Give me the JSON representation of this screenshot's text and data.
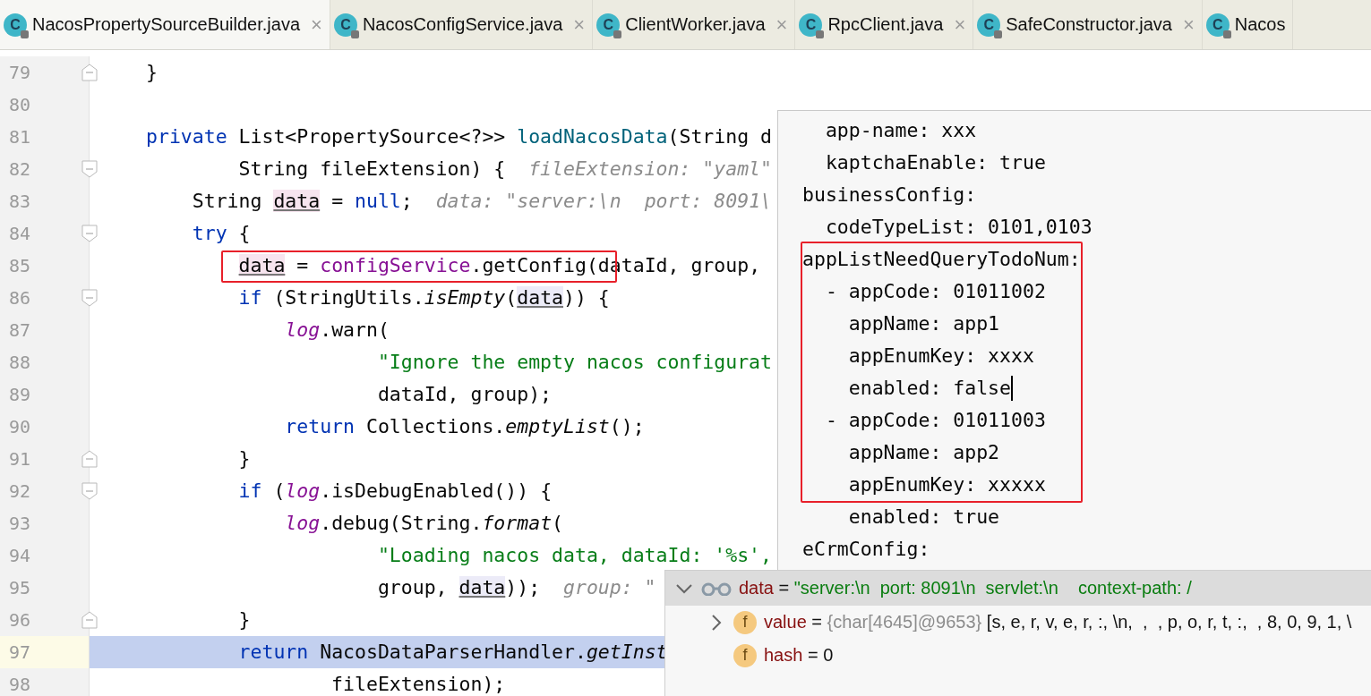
{
  "tabs": [
    {
      "icon": "C",
      "label": "NacosPropertySourceBuilder.java",
      "close": "×",
      "selected": true
    },
    {
      "icon": "C",
      "label": "NacosConfigService.java",
      "close": "×",
      "selected": false
    },
    {
      "icon": "C",
      "label": "ClientWorker.java",
      "close": "×",
      "selected": false
    },
    {
      "icon": "C",
      "label": "RpcClient.java",
      "close": "×",
      "selected": false
    },
    {
      "icon": "C",
      "label": "SafeConstructor.java",
      "close": "×",
      "selected": false
    },
    {
      "icon": "C",
      "label": "Nacos",
      "selected": false
    }
  ],
  "code_lines": [
    {
      "number": "79",
      "fold_end": true,
      "current": false,
      "tokens": [
        {
          "kind": "plain",
          "text": "}"
        }
      ]
    },
    {
      "number": "80",
      "current": false
    },
    {
      "number": "81",
      "current": false,
      "tokens": [
        {
          "kind": "keyword",
          "text": "private"
        },
        {
          "kind": "plain",
          "text": " List<PropertySource<?>> "
        },
        {
          "kind": "method",
          "text": "loadNacosData"
        },
        {
          "kind": "plain",
          "text": "(String d"
        }
      ]
    },
    {
      "number": "82",
      "fold_start": true,
      "current": false,
      "tokens": [
        {
          "kind": "plain",
          "text": "        String fileExtension) {"
        },
        {
          "kind": "hint",
          "text": "  fileExtension: \"yaml\""
        }
      ]
    },
    {
      "number": "83",
      "current": false,
      "tokens": [
        {
          "kind": "plain",
          "text": "    String "
        },
        {
          "kind": "var-write",
          "text": "data"
        },
        {
          "kind": "plain",
          "text": " = "
        },
        {
          "kind": "keyword",
          "text": "null"
        },
        {
          "kind": "plain",
          "text": ";"
        },
        {
          "kind": "hint",
          "text": "  data: \"server:\\n  port: 8091\\"
        }
      ]
    },
    {
      "number": "84",
      "fold_start": true,
      "current": false,
      "tokens": [
        {
          "kind": "keyword",
          "text": "    try"
        },
        {
          "kind": "plain",
          "text": " {"
        }
      ]
    },
    {
      "number": "85",
      "current": false,
      "boxed": true,
      "tokens": [
        {
          "kind": "var-write",
          "text": "        data"
        },
        {
          "kind": "plain",
          "text": " = "
        },
        {
          "kind": "field",
          "text": "configService"
        },
        {
          "kind": "plain",
          "text": ".getConfig(dataId, group,"
        }
      ]
    },
    {
      "number": "86",
      "fold_start": true,
      "current": false,
      "tokens": [
        {
          "kind": "keyword",
          "text": "        if"
        },
        {
          "kind": "plain",
          "text": " (StringUtils."
        },
        {
          "kind": "italic",
          "text": "isEmpty"
        },
        {
          "kind": "plain",
          "text": "("
        },
        {
          "kind": "var-read",
          "text": "data"
        },
        {
          "kind": "plain",
          "text": ")) {"
        }
      ]
    },
    {
      "number": "87",
      "current": false,
      "tokens": [
        {
          "kind": "static-field",
          "text": "            log"
        },
        {
          "kind": "plain",
          "text": ".warn("
        }
      ]
    },
    {
      "number": "88",
      "current": false,
      "tokens": [
        {
          "kind": "string",
          "text": "                    \"Ignore the empty nacos configurat"
        }
      ]
    },
    {
      "number": "89",
      "current": false,
      "tokens": [
        {
          "kind": "plain",
          "text": "                    dataId, group);"
        }
      ]
    },
    {
      "number": "90",
      "current": false,
      "tokens": [
        {
          "kind": "keyword",
          "text": "            return"
        },
        {
          "kind": "plain",
          "text": " Collections."
        },
        {
          "kind": "italic",
          "text": "emptyList"
        },
        {
          "kind": "plain",
          "text": "();"
        }
      ]
    },
    {
      "number": "91",
      "fold_end": true,
      "current": false,
      "tokens": [
        {
          "kind": "plain",
          "text": "        }"
        }
      ]
    },
    {
      "number": "92",
      "fold_start": true,
      "current": false,
      "tokens": [
        {
          "kind": "keyword",
          "text": "        if"
        },
        {
          "kind": "plain",
          "text": " ("
        },
        {
          "kind": "static-field",
          "text": "log"
        },
        {
          "kind": "plain",
          "text": ".isDebugEnabled()) {"
        }
      ]
    },
    {
      "number": "93",
      "current": false,
      "tokens": [
        {
          "kind": "static-field",
          "text": "            log"
        },
        {
          "kind": "plain",
          "text": ".debug(String."
        },
        {
          "kind": "italic",
          "text": "format"
        },
        {
          "kind": "plain",
          "text": "("
        }
      ]
    },
    {
      "number": "94",
      "current": false,
      "tokens": [
        {
          "kind": "string",
          "text": "                    \"Loading nacos data, dataId: '%s',"
        }
      ]
    },
    {
      "number": "95",
      "current": false,
      "tokens": [
        {
          "kind": "plain",
          "text": "                    group, "
        },
        {
          "kind": "var-read",
          "text": "data"
        },
        {
          "kind": "plain",
          "text": "));"
        },
        {
          "kind": "hint",
          "text": "  group: \""
        }
      ]
    },
    {
      "number": "96",
      "fold_end": true,
      "current": false,
      "tokens": [
        {
          "kind": "plain",
          "text": "        }"
        }
      ]
    },
    {
      "number": "97",
      "current": true,
      "tokens": [
        {
          "kind": "keyword",
          "text": "        return"
        },
        {
          "kind": "plain",
          "text": " NacosDataParserHandler."
        },
        {
          "kind": "italic",
          "text": "getInst"
        }
      ]
    },
    {
      "number": "98",
      "current": false,
      "tokens": [
        {
          "kind": "plain",
          "text": "                fileExtension);"
        }
      ]
    }
  ],
  "value_popup": {
    "blocks": [
      {
        "kind": "plain",
        "lines": [
          {
            "text": "  app-name: xxx"
          },
          {
            "text": "  kaptchaEnable: true"
          },
          {
            "text": "businessConfig:"
          },
          {
            "text": "  codeTypeList: 0101,0103"
          }
        ]
      },
      {
        "kind": "framed",
        "lines": [
          {
            "text": "appListNeedQueryTodoNum:"
          },
          {
            "text": "  - appCode: 01011002"
          },
          {
            "text": "    appName: app1"
          },
          {
            "text": "    appEnumKey: xxxx"
          },
          {
            "text": "    enabled: false",
            "cursor": true
          },
          {
            "text": "  - appCode: 01011003"
          },
          {
            "text": "    appName: app2"
          },
          {
            "text": "    appEnumKey: xxxxx"
          }
        ]
      },
      {
        "kind": "plain",
        "lines": [
          {
            "text": "    enabled: true"
          },
          {
            "text": "eCrmConfig:"
          }
        ]
      }
    ]
  },
  "debug_tree": [
    {
      "kind": "watch",
      "name": "data",
      "separator": "=",
      "value": "\"server:\\n  port: 8091\\n  servlet:\\n    context-path: /",
      "expanded": true
    },
    {
      "kind": "field",
      "badge": "f",
      "name": "value",
      "separator": "=",
      "type": "{char[4645]@9653}",
      "value": "[s, e, r, v, e, r, :, \\n,  ,  , p, o, r, t, :,  , 8, 0, 9, 1, \\",
      "expanded": false
    },
    {
      "kind": "field",
      "badge": "f",
      "name": "hash",
      "separator": "=",
      "value": "0"
    }
  ]
}
